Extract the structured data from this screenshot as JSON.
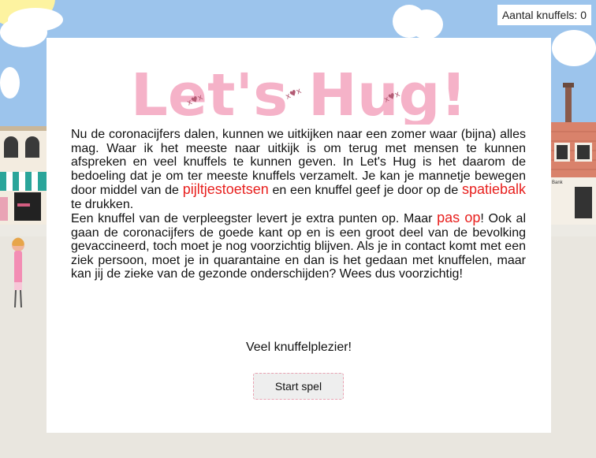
{
  "hud": {
    "hug_counter": "Aantal knuffels: 0"
  },
  "intro": {
    "logo_text": "Let's Hug!",
    "paragraph1": [
      "Nu de coronacijfers dalen, kunnen we uitkijken naar een zomer waar (bijna) alles mag. Waar ik het meeste naar uitkijk is om terug met mensen te kunnen afspreken en veel knuffels te kunnen geven. In Let's Hug is het daarom de bedoeling dat je om ter meeste knuffels verzamelt. Je kan je mannetje bewegen door middel van de ",
      "pijltjestoetsen",
      " en een knuffel geef je door op de ",
      "spatiebalk",
      " te drukken."
    ],
    "paragraph2": [
      "Een knuffel van de verpleegster levert je extra punten op. Maar ",
      "pas op",
      "! Ook al gaan de coronacijfers de goede kant op en is een groot deel van de bevolking gevaccineerd, toch moet je nog voorzichtig blijven. Als je in contact komt met een ziek persoon, moet je in quarantaine en dan is het gedaan met knuffelen, maar kan jij de zieke van de gezonde onderschijden? Wees dus voorzichtig!"
    ],
    "closing": "Veel knuffelplezier!",
    "start_button": "Start spel"
  },
  "scene": {
    "bank_sign": "Bank"
  },
  "colors": {
    "logo_pink": "#f5b2c8",
    "highlight_red": "#e8201e",
    "button_border": "#e9a1b2",
    "sky": "#9cc4ec"
  }
}
